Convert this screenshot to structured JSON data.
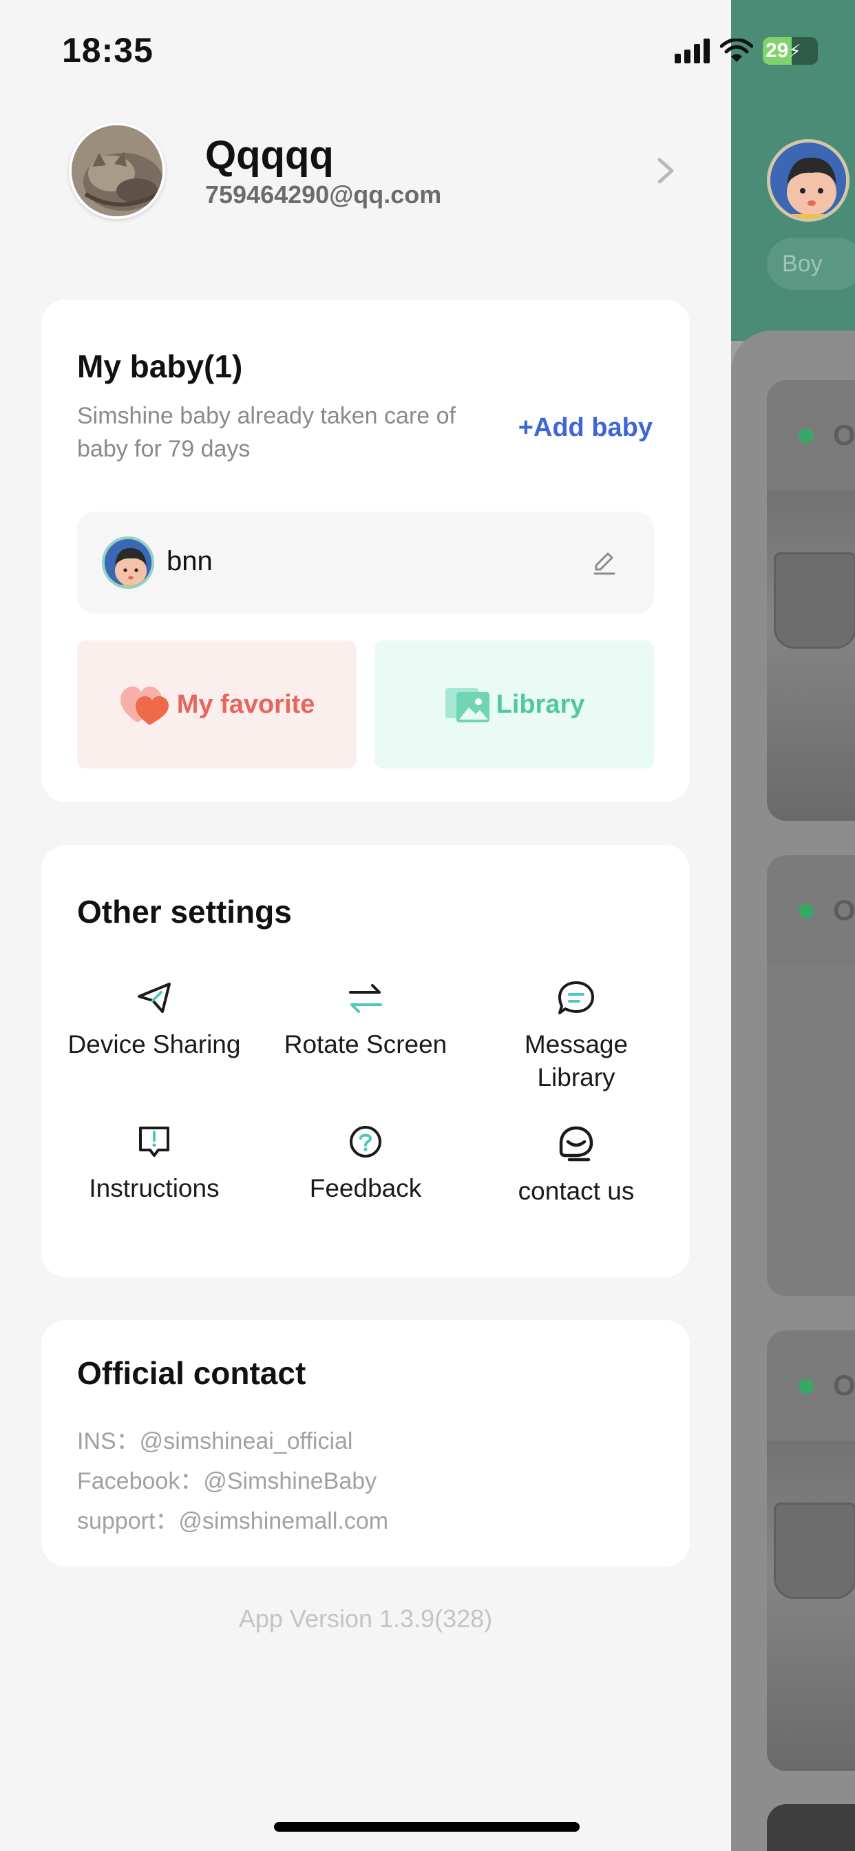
{
  "status_bar": {
    "time": "18:35",
    "battery": "29"
  },
  "profile": {
    "name": "Qqqqq",
    "email": "759464290@qq.com"
  },
  "baby_card": {
    "title": "My baby(1)",
    "description": "Simshine baby already taken care of baby for 79 days",
    "add_label": "+Add baby",
    "baby_name": "bnn",
    "favorite_label": "My favorite",
    "library_label": "Library"
  },
  "settings": {
    "title": "Other settings",
    "items": [
      {
        "label": "Device Sharing",
        "icon": "send-icon"
      },
      {
        "label": "Rotate Screen",
        "icon": "rotate-arrows-icon"
      },
      {
        "label": "Message Library",
        "icon": "chat-bubble-icon"
      },
      {
        "label": "Instructions",
        "icon": "info-book-icon"
      },
      {
        "label": "Feedback",
        "icon": "question-icon"
      },
      {
        "label": "contact us",
        "icon": "headset-chat-icon"
      }
    ]
  },
  "official_contact": {
    "title": "Official contact",
    "lines": [
      "INS：@simshineai_official",
      "Facebook：@SimshineBaby",
      "support：@simshinemall.com"
    ]
  },
  "app_version": "App Version 1.3.9(328)",
  "background_app": {
    "chip_label": "Boy",
    "status_letter": "O"
  },
  "colors": {
    "accent_blue": "#3f66d6",
    "favorite_red": "#e8655d",
    "library_green": "#4fc7a2",
    "teal_header": "#4b8c76"
  }
}
